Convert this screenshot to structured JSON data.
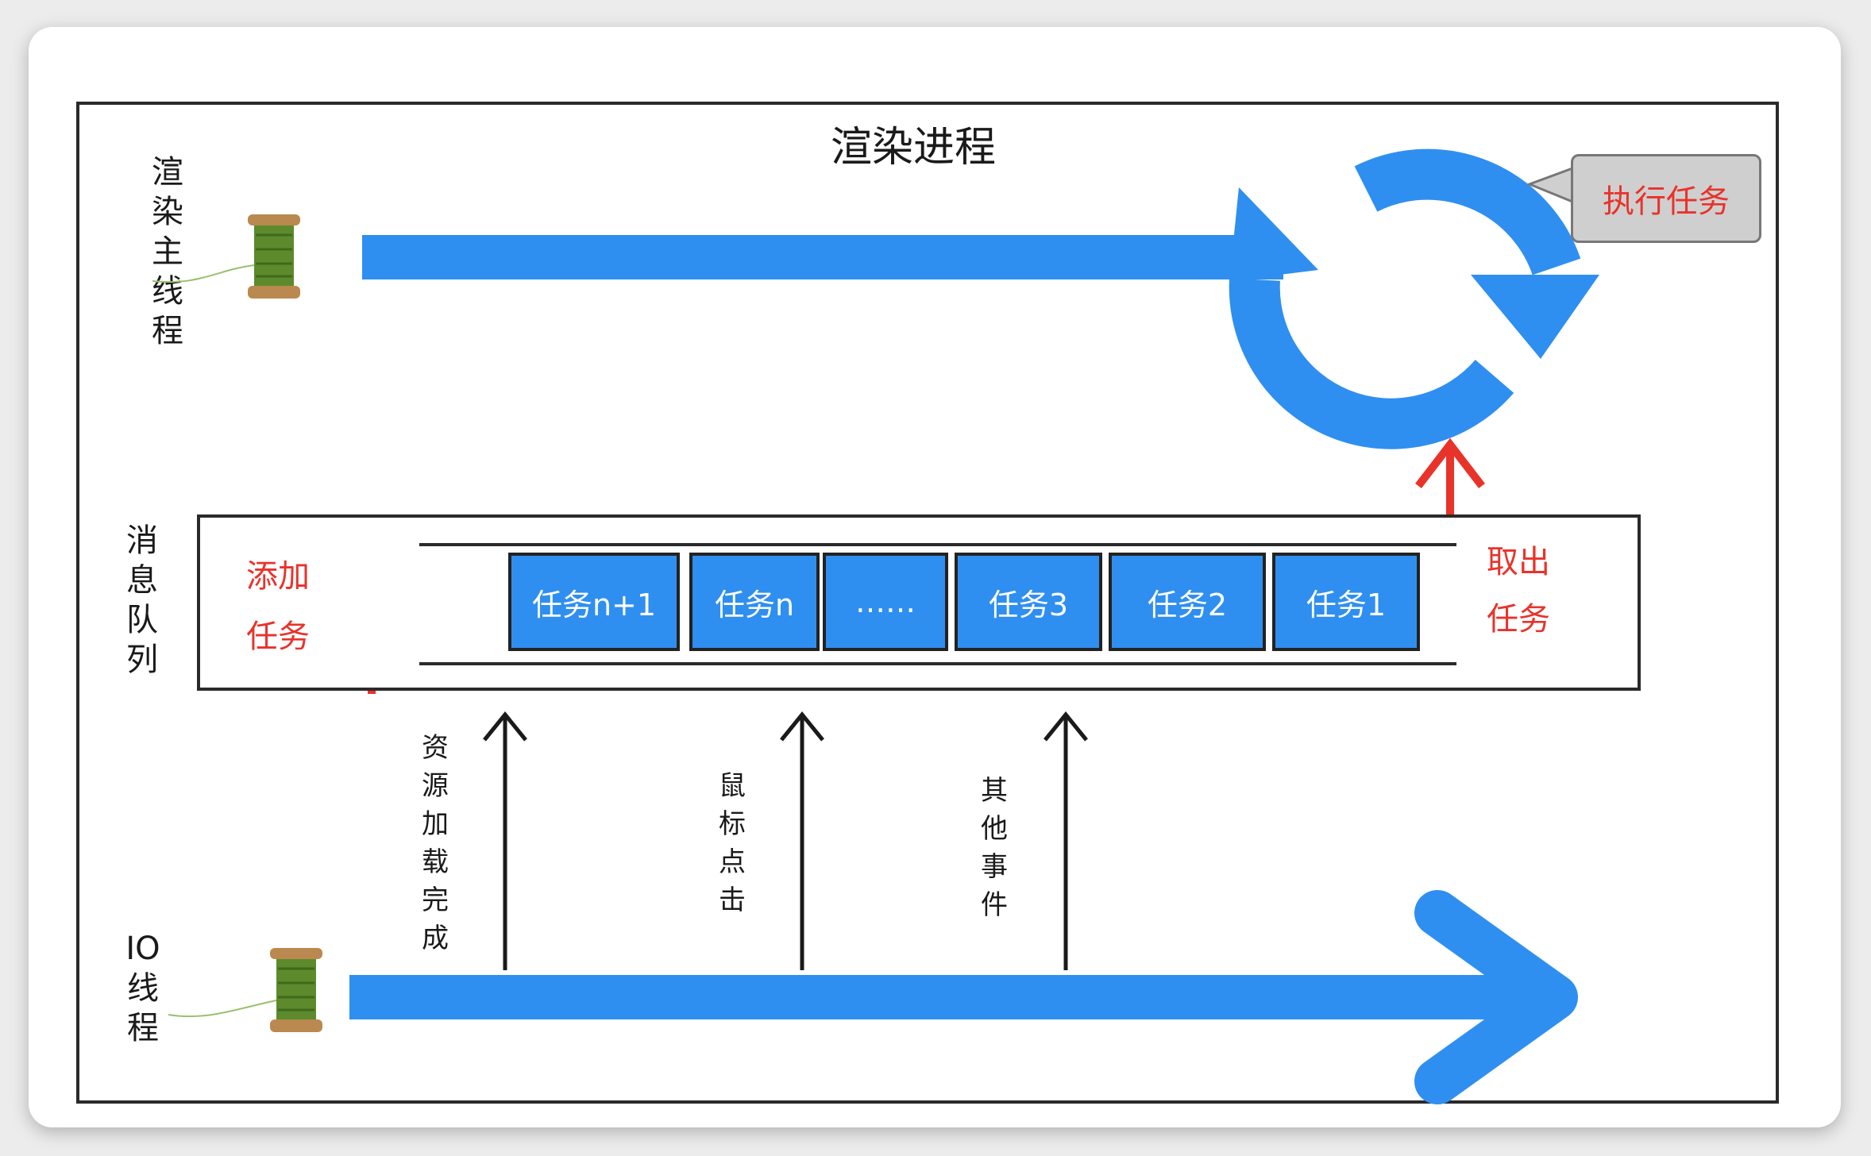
{
  "title": "渲染进程",
  "render_thread_label": "渲染主线程",
  "message_queue_label": "消息队列",
  "io_thread_label": "IO线程",
  "add_task_line1": "添加",
  "add_task_line2": "任务",
  "take_task_line1": "取出",
  "take_task_line2": "任务",
  "execute_task": "执行任务",
  "tasks": [
    "任务n+1",
    "任务n",
    "……",
    "任务3",
    "任务2",
    "任务1"
  ],
  "events": [
    "资源加载完成",
    "鼠标点击",
    "其他事件"
  ],
  "colors": {
    "blue": "#2f8ff0",
    "red": "#e8332b",
    "callout_bg": "#cfcfcf"
  },
  "icons": [
    "thread-spool-icon",
    "loop-arrow-icon"
  ]
}
